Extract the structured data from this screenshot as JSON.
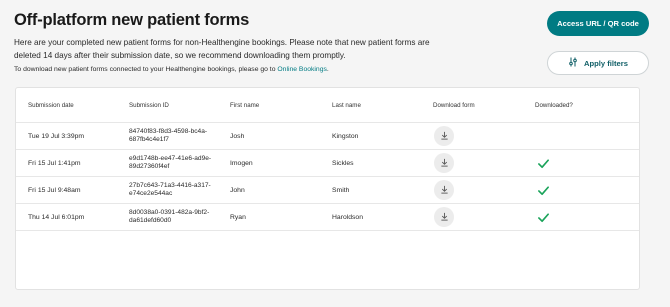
{
  "page": {
    "title": "Off-platform new patient forms",
    "intro_line1": "Here are your completed new patient forms for non-Healthengine bookings. Please note that new patient forms are deleted 14 days after their submission date, so we recommend downloading them promptly.",
    "intro2_prefix": "To download new patient forms connected to your Healthengine bookings, please go to ",
    "intro2_link": "Online Bookings",
    "intro2_suffix": "."
  },
  "actions": {
    "access_label": "Access URL / QR code",
    "filters_label": "Apply filters",
    "filters_icon": "sliders-icon"
  },
  "table": {
    "headers": {
      "date": "Submission date",
      "id": "Submission ID",
      "first": "First name",
      "last": "Last name",
      "download": "Download form",
      "downloaded": "Downloaded?"
    },
    "rows": [
      {
        "date": "Tue 19 Jul 3:39pm",
        "id": "84740f83-f8d3-4598-bc4a-687fb4c4e1f7",
        "first": "Josh",
        "last": "Kingston",
        "downloaded": false
      },
      {
        "date": "Fri 15 Jul 1:41pm",
        "id": "e9d1748b-ee47-41e6-ad9e-89d27360f4ef",
        "first": "Imogen",
        "last": "Sickles",
        "downloaded": true
      },
      {
        "date": "Fri 15 Jul 9:48am",
        "id": "27b7c643-71a3-4416-a317-e74ce2e544ac",
        "first": "John",
        "last": "Smith",
        "downloaded": true
      },
      {
        "date": "Thu 14 Jul 6:01pm",
        "id": "8d0038a0-0391-482a-9bf2-da61defd60d0",
        "first": "Ryan",
        "last": "Haroldson",
        "downloaded": true
      }
    ]
  },
  "colors": {
    "brand": "#007b83",
    "check": "#1aa35a"
  }
}
